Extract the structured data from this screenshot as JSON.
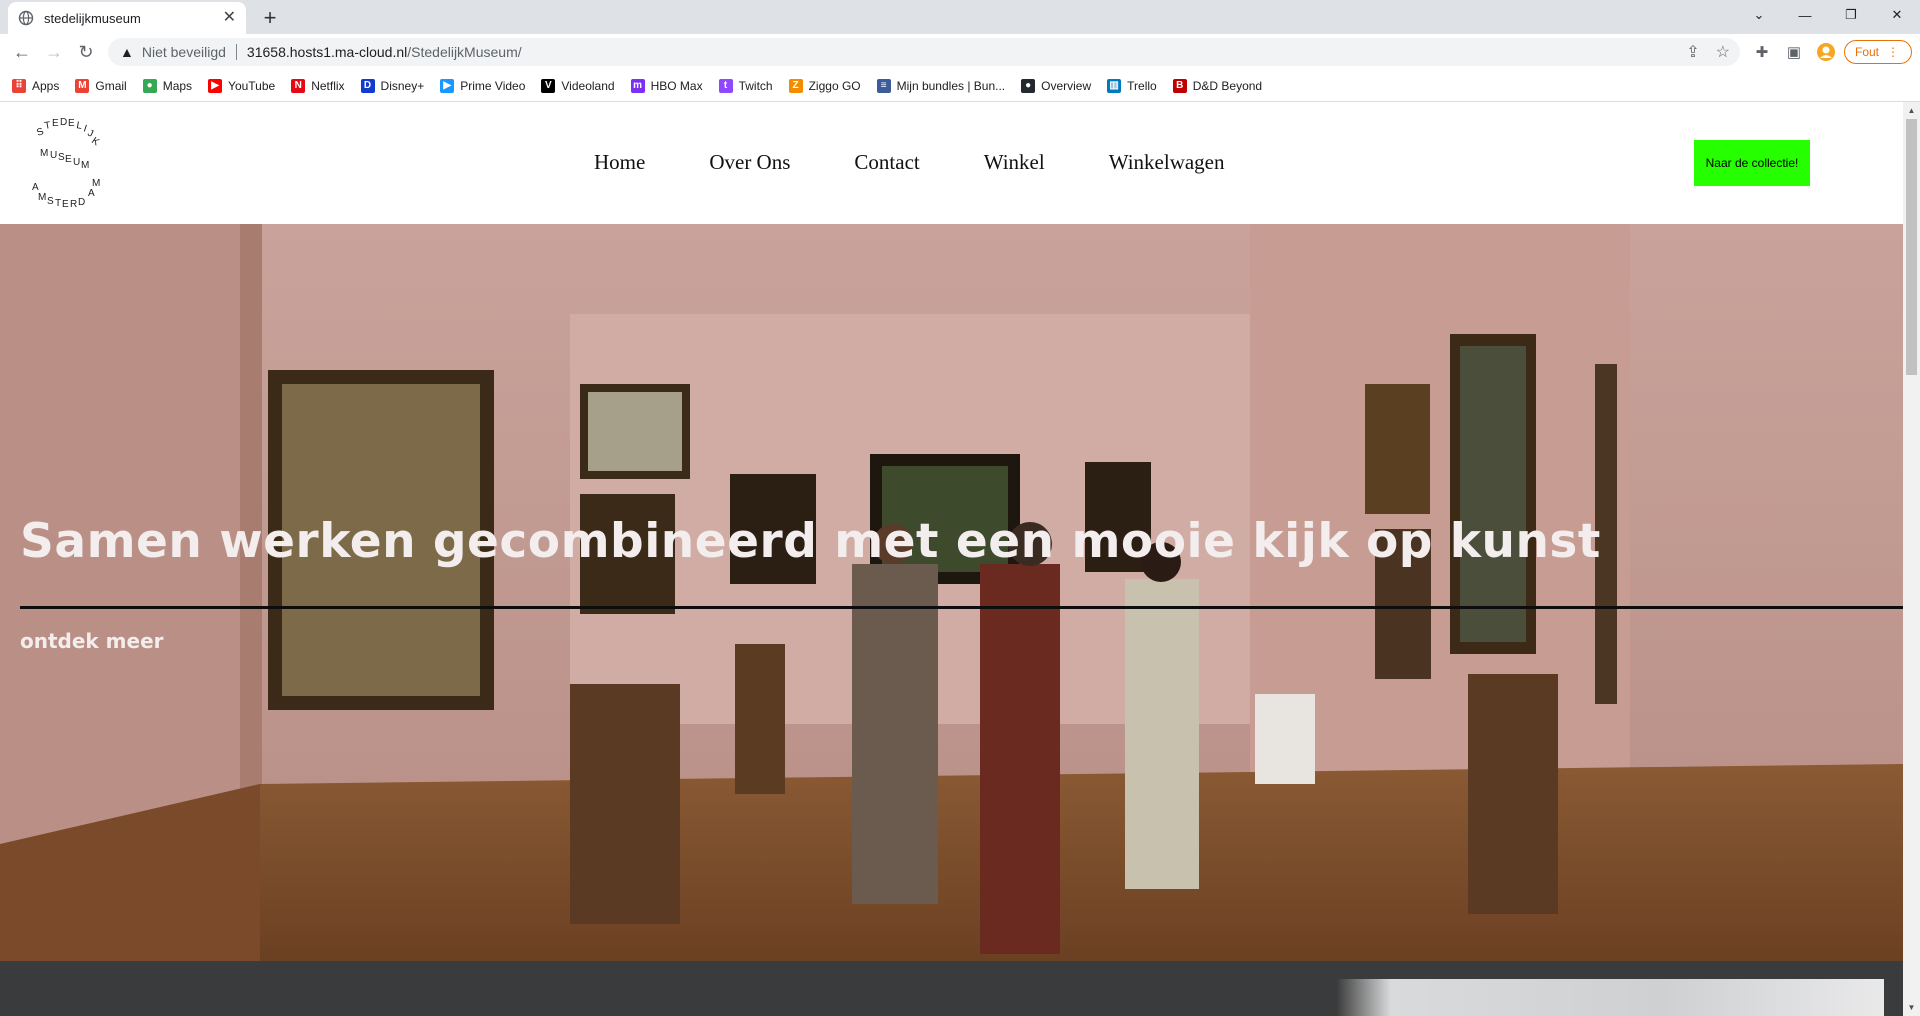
{
  "browser": {
    "tab_title": "stedelijkmuseum",
    "security_label": "Niet beveiligd",
    "url_host": "31658.hosts1.ma-cloud.nl",
    "url_path": "/StedelijkMuseum/",
    "profile_label": "Fout",
    "bookmarks": [
      {
        "label": "Apps",
        "icon": "apps-grid-icon",
        "color": "#ea4335"
      },
      {
        "label": "Gmail",
        "icon": "gmail-icon",
        "color": "#ea4335"
      },
      {
        "label": "Maps",
        "icon": "maps-pin-icon",
        "color": "#34a853"
      },
      {
        "label": "YouTube",
        "icon": "youtube-icon",
        "color": "#ff0000"
      },
      {
        "label": "Netflix",
        "icon": "netflix-icon",
        "color": "#e50914"
      },
      {
        "label": "Disney+",
        "icon": "disney-icon",
        "color": "#113ccf"
      },
      {
        "label": "Prime Video",
        "icon": "prime-video-icon",
        "color": "#1a98ff"
      },
      {
        "label": "Videoland",
        "icon": "videoland-icon",
        "color": "#000000"
      },
      {
        "label": "HBO Max",
        "icon": "hbo-max-icon",
        "color": "#7b2ff7"
      },
      {
        "label": "Twitch",
        "icon": "twitch-icon",
        "color": "#9146ff"
      },
      {
        "label": "Ziggo GO",
        "icon": "ziggo-icon",
        "color": "#f48c00"
      },
      {
        "label": "Mijn bundles | Bun...",
        "icon": "bundles-icon",
        "color": "#3b5b9b"
      },
      {
        "label": "Overview",
        "icon": "github-icon",
        "color": "#24292f"
      },
      {
        "label": "Trello",
        "icon": "trello-icon",
        "color": "#0079bf"
      },
      {
        "label": "D&D Beyond",
        "icon": "dnd-beyond-icon",
        "color": "#c00000"
      }
    ]
  },
  "site": {
    "logo_letters_top": "STEDELIJK",
    "logo_letters_mid": "MUSEUM",
    "logo_letters_bottom": "AMSTERDAM",
    "nav": [
      "Home",
      "Over Ons",
      "Contact",
      "Winkel",
      "Winkelwagen"
    ],
    "cta_label": "Naar de collectie!",
    "hero_title": "Samen werken gecombineerd met een mooie kijk op kunst",
    "hero_link": "ontdek meer",
    "accent_color": "#26ff00"
  }
}
